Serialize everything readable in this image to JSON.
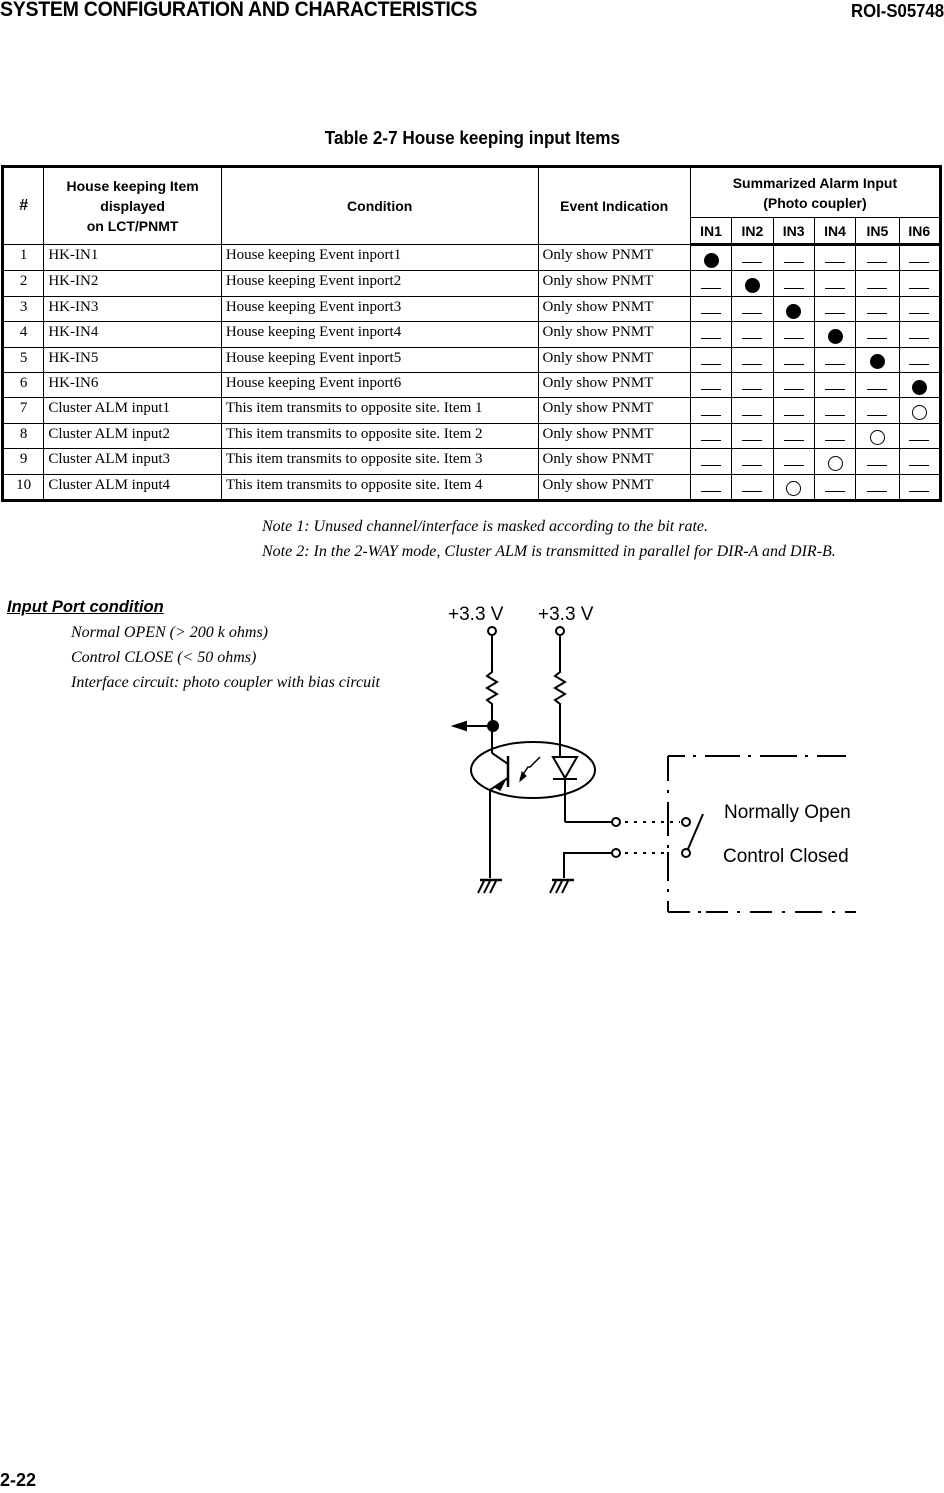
{
  "header": {
    "section_title": "SYSTEM CONFIGURATION AND CHARACTERISTICS",
    "doc_id": "ROI-S05748"
  },
  "table": {
    "title": "Table 2-7  House keeping input Items",
    "headers": {
      "num": "#",
      "item_line1": "House keeping Item",
      "item_line2": "displayed",
      "item_line3": "on LCT/PNMT",
      "condition": "Condition",
      "event": "Event Indication",
      "alarm_line1": "Summarized Alarm Input",
      "alarm_line2": "(Photo coupler)",
      "inputs": [
        "IN1",
        "IN2",
        "IN3",
        "IN4",
        "IN5",
        "IN6"
      ]
    },
    "mark_legend": {
      "filled": "●",
      "open": "○",
      "none": "—"
    },
    "rows": [
      {
        "num": "1",
        "item": "HK-IN1",
        "condition": "House keeping Event inport1",
        "event": "Only show PNMT",
        "marks": [
          "filled",
          "none",
          "none",
          "none",
          "none",
          "none"
        ]
      },
      {
        "num": "2",
        "item": "HK-IN2",
        "condition": "House keeping Event inport2",
        "event": "Only show PNMT",
        "marks": [
          "none",
          "filled",
          "none",
          "none",
          "none",
          "none"
        ]
      },
      {
        "num": "3",
        "item": "HK-IN3",
        "condition": "House keeping Event inport3",
        "event": "Only show PNMT",
        "marks": [
          "none",
          "none",
          "filled",
          "none",
          "none",
          "none"
        ]
      },
      {
        "num": "4",
        "item": "HK-IN4",
        "condition": "House keeping Event inport4",
        "event": "Only show PNMT",
        "marks": [
          "none",
          "none",
          "none",
          "filled",
          "none",
          "none"
        ]
      },
      {
        "num": "5",
        "item": "HK-IN5",
        "condition": "House keeping Event inport5",
        "event": "Only show PNMT",
        "marks": [
          "none",
          "none",
          "none",
          "none",
          "filled",
          "none"
        ]
      },
      {
        "num": "6",
        "item": "HK-IN6",
        "condition": "House keeping Event inport6",
        "event": "Only show PNMT",
        "marks": [
          "none",
          "none",
          "none",
          "none",
          "none",
          "filled"
        ]
      },
      {
        "num": "7",
        "item": "Cluster ALM input1",
        "condition": "This item transmits to opposite site. Item 1",
        "event": "Only show PNMT",
        "marks": [
          "none",
          "none",
          "none",
          "none",
          "none",
          "open"
        ]
      },
      {
        "num": "8",
        "item": "Cluster ALM input2",
        "condition": "This item transmits to opposite site. Item 2",
        "event": "Only show PNMT",
        "marks": [
          "none",
          "none",
          "none",
          "none",
          "open",
          "none"
        ]
      },
      {
        "num": "9",
        "item": "Cluster ALM input3",
        "condition": "This item transmits to opposite site. Item 3",
        "event": "Only show PNMT",
        "marks": [
          "none",
          "none",
          "none",
          "open",
          "none",
          "none"
        ]
      },
      {
        "num": "10",
        "item": "Cluster ALM input4",
        "condition": "This item transmits to opposite site. Item 4",
        "event": "Only show PNMT",
        "marks": [
          "none",
          "none",
          "open",
          "none",
          "none",
          "none"
        ]
      }
    ]
  },
  "notes": [
    "Note 1:  Unused channel/interface is masked according to the bit rate.",
    "Note 2:  In the 2-WAY mode, Cluster ALM is transmitted in parallel for DIR-A and DIR-B."
  ],
  "input_port": {
    "title": "Input Port condition",
    "lines": [
      "Normal OPEN (> 200 k ohms)",
      "Control CLOSE (< 50 ohms)",
      "Interface circuit: photo coupler with bias circuit"
    ]
  },
  "circuit": {
    "supply_left": "+3.3 V",
    "supply_right": "+3.3 V",
    "switch_label_open": "Normally Open",
    "switch_label_closed": "Control Closed"
  },
  "footer": {
    "page_number": "2-22"
  }
}
